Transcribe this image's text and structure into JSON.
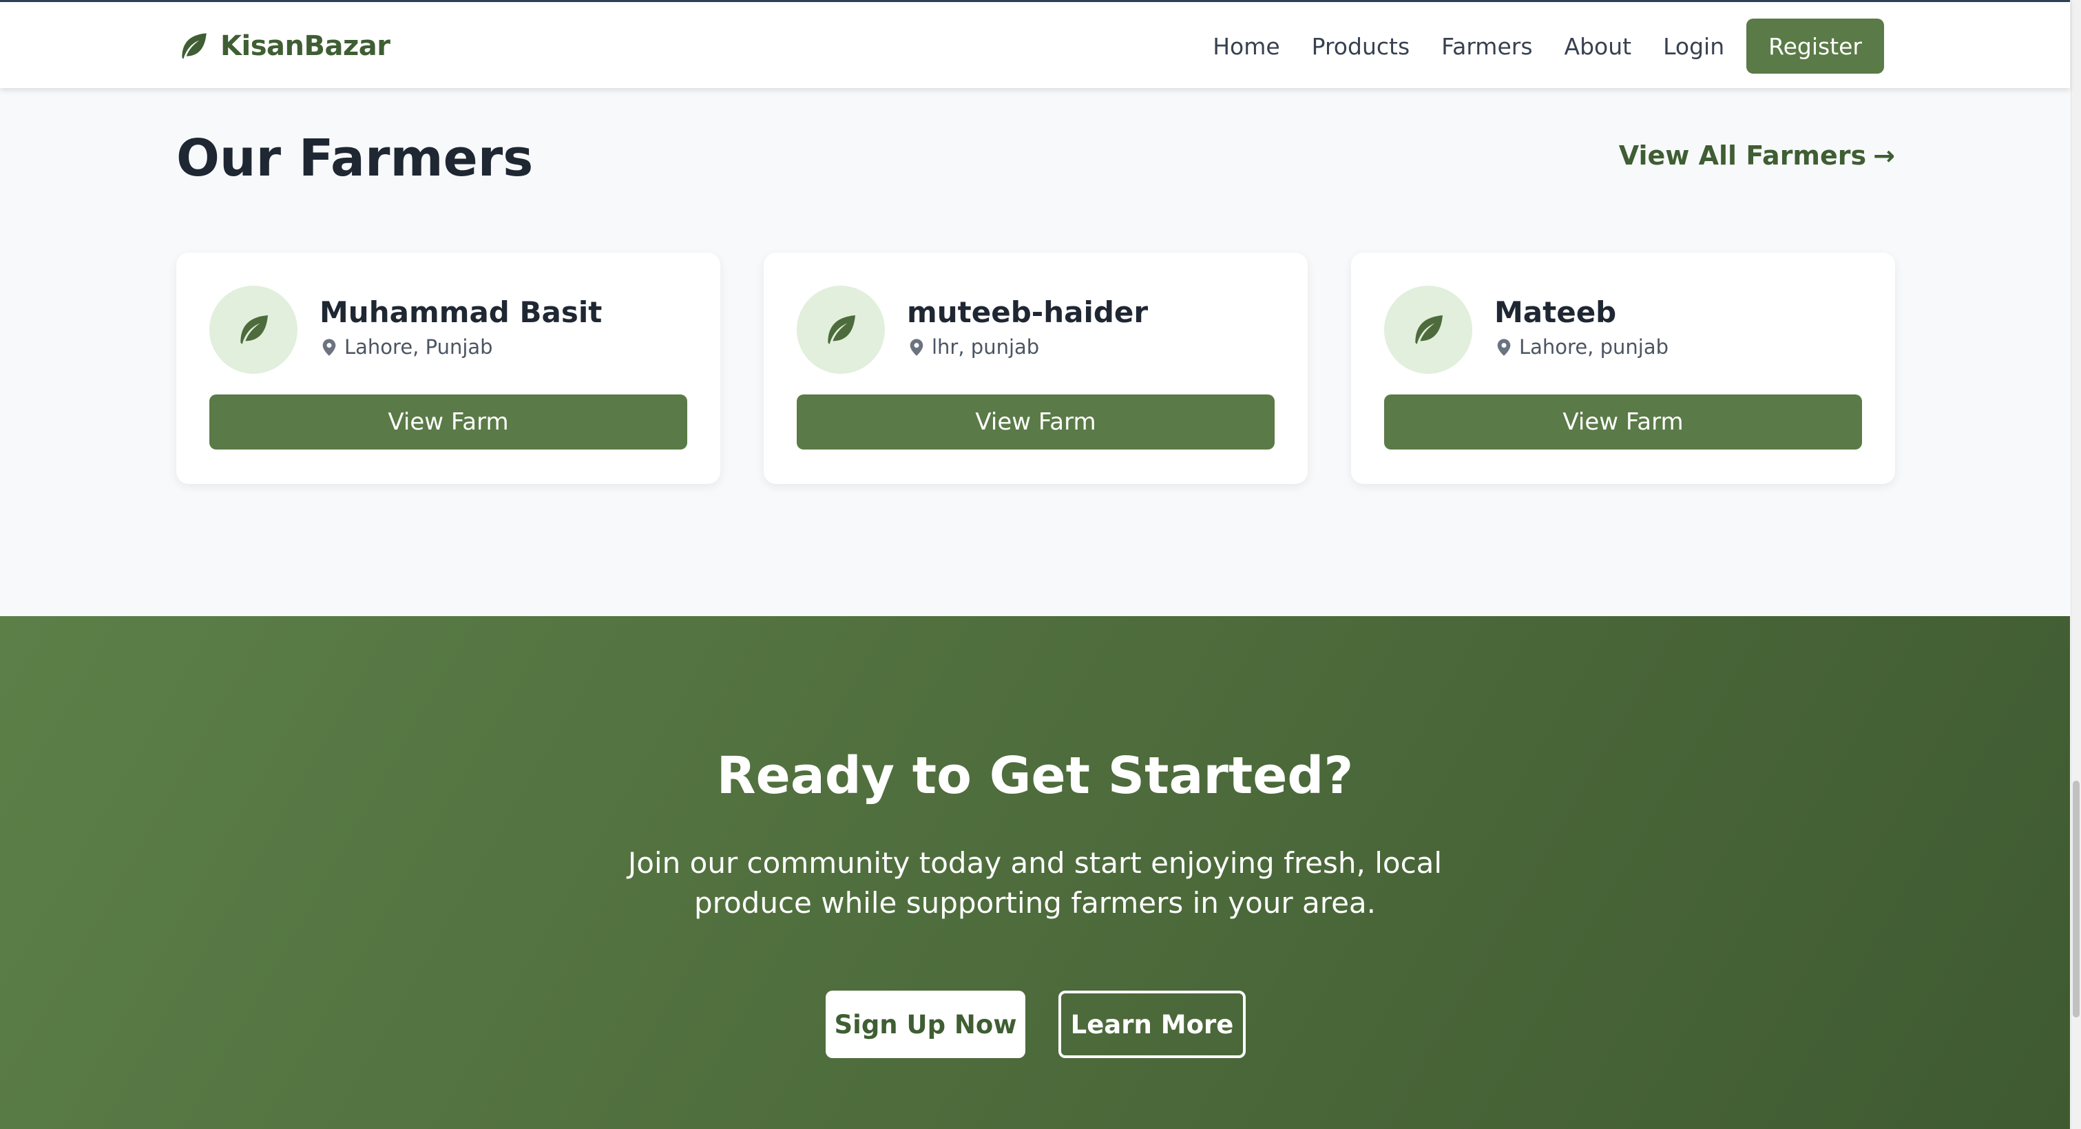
{
  "brand": {
    "name": "KisanBazar",
    "icon": "leaf-icon",
    "color": "#3f5e33"
  },
  "nav": {
    "links": [
      "Home",
      "Products",
      "Farmers",
      "About",
      "Login"
    ],
    "register_label": "Register"
  },
  "farmers_section": {
    "title": "Our Farmers",
    "view_all_label": "View All Farmers",
    "view_all_arrow": "→",
    "farmers": [
      {
        "name": "Muhammad Basit",
        "location": "Lahore, Punjab",
        "button": "View Farm"
      },
      {
        "name": "muteeb-haider",
        "location": "lhr, punjab",
        "button": "View Farm"
      },
      {
        "name": "Mateeb",
        "location": "Lahore, punjab",
        "button": "View Farm"
      }
    ]
  },
  "cta": {
    "title": "Ready to Get Started?",
    "text": "Join our community today and start enjoying fresh, local produce while supporting farmers in your area.",
    "signup_label": "Sign Up Now",
    "learn_more_label": "Learn More"
  },
  "colors": {
    "accent": "#5a7a47",
    "accent_dark": "#3f5e33",
    "avatar_bg": "#e1efdc",
    "page_bg": "#f8f9fb"
  }
}
